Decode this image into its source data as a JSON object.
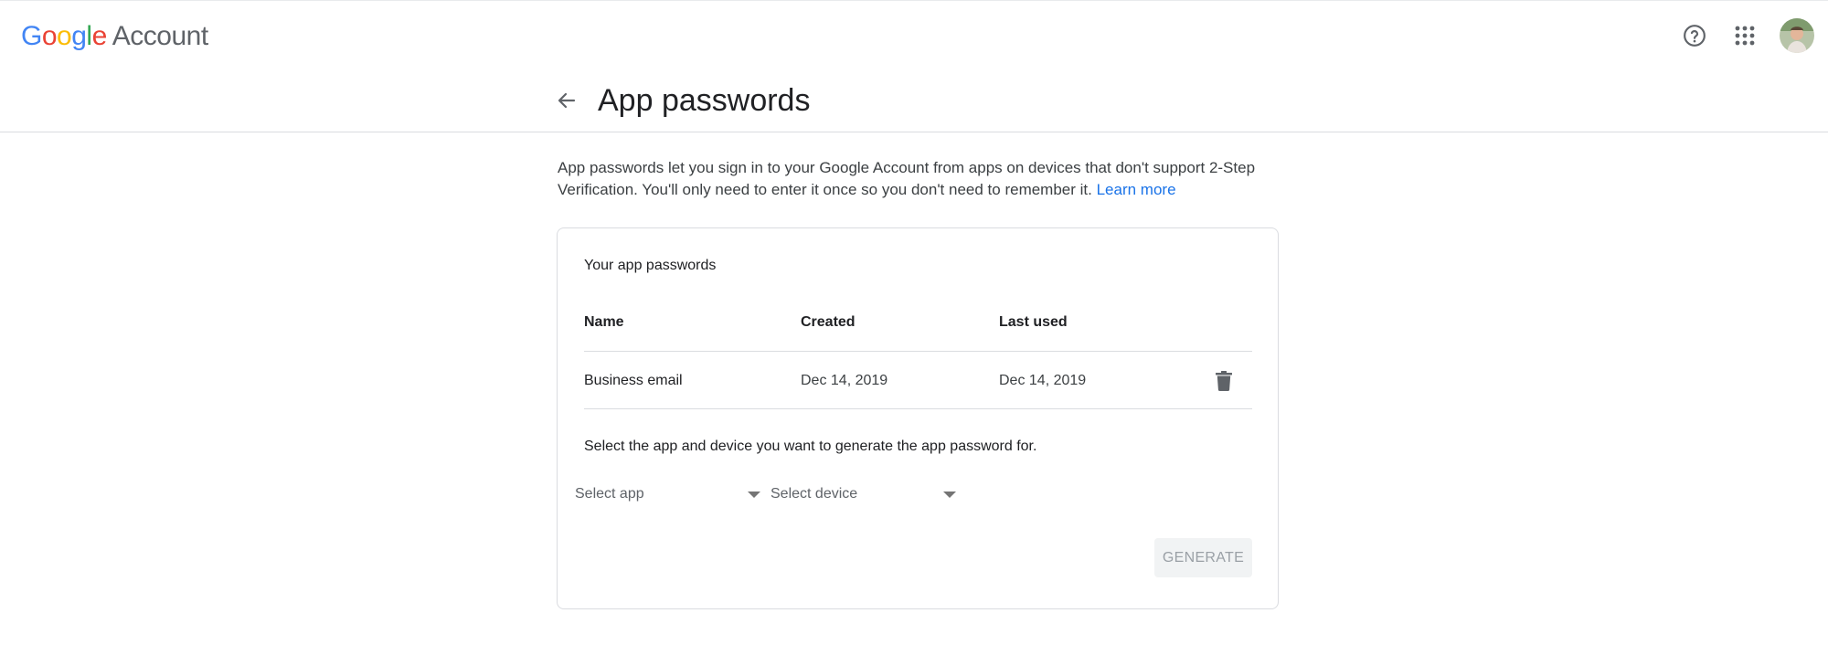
{
  "topbar": {
    "brand_letters": [
      "G",
      "o",
      "o",
      "g",
      "l",
      "e"
    ],
    "brand_suffix": "Account",
    "icons": {
      "help": "help-circle-icon",
      "apps": "apps-grid-icon",
      "avatar": "user-avatar"
    }
  },
  "header": {
    "back_icon": "arrow-back-icon",
    "title": "App passwords"
  },
  "intro": {
    "text": "App passwords let you sign in to your Google Account from apps on devices that don't support 2-Step Verification. You'll only need to enter it once so you don't need to remember it.",
    "link": "Learn more"
  },
  "card": {
    "title": "Your app passwords",
    "columns": [
      "Name",
      "Created",
      "Last used"
    ],
    "rows": [
      {
        "name": "Business email",
        "created": "Dec 14, 2019",
        "last_used": "Dec 14, 2019",
        "delete_icon": "trash-icon"
      }
    ],
    "select_prompt": "Select the app and device you want to generate the app password for.",
    "app_select": "Select app",
    "device_select": "Select device",
    "generate_label": "GENERATE"
  },
  "colors": {
    "accent_link": "#1a73e8",
    "google_blue": "#4285f4",
    "google_red": "#ea4335",
    "google_yellow": "#fbbc05",
    "google_green": "#34a853",
    "border": "#dadce0",
    "button_disabled_bg": "#f1f3f4",
    "button_disabled_text": "#9aa0a6"
  }
}
